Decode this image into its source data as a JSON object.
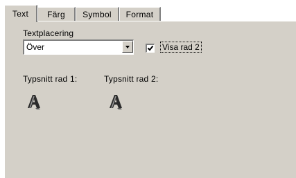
{
  "tabs": [
    {
      "label": "Text",
      "active": true
    },
    {
      "label": "Färg",
      "active": false
    },
    {
      "label": "Symbol",
      "active": false
    },
    {
      "label": "Format",
      "active": false
    }
  ],
  "placement": {
    "label": "Textplacering",
    "selected": "Över"
  },
  "show_line2": {
    "label": "Visa rad 2",
    "checked": true
  },
  "font_line1": {
    "label": "Typsnitt rad 1:",
    "icon": "font-icon"
  },
  "font_line2": {
    "label": "Typsnitt rad 2:",
    "icon": "font-icon"
  },
  "colors": {
    "panel": "#d4d0c8",
    "shadow": "#808080",
    "highlight": "#ffffff"
  }
}
